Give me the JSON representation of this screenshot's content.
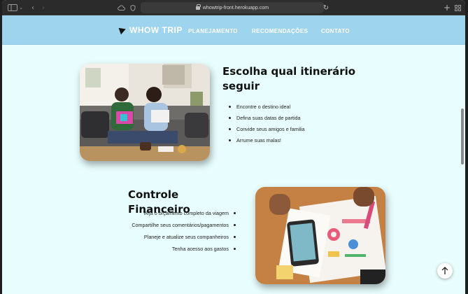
{
  "browser": {
    "url": "whowtrip-front.herokuapp.com"
  },
  "nav": {
    "logo": "WHOW TRIP",
    "links": [
      "PLANEJAMENTO",
      "RECOMENDAÇÕES",
      "CONTATO"
    ]
  },
  "section1": {
    "title": "Escolha qual itinerário seguir",
    "items": [
      "Encontre o destino ideal",
      "Defina suas datas de partida",
      "Convide seus amigos e familia",
      "Arrume suas malas!"
    ]
  },
  "section2": {
    "title": "Controle Financeiro",
    "items": [
      "Veja o orçamento completo da viagem",
      "Compartilhe seus comentários/pagamentos",
      "Planeje e atualize seus companheiros",
      "Tenha acesso aos gastos"
    ]
  },
  "colors": {
    "nav_bg": "#9fd4ee",
    "page_bg": "#e8fdfd"
  },
  "icons": {
    "back_to_top": "arrow-up-icon"
  }
}
